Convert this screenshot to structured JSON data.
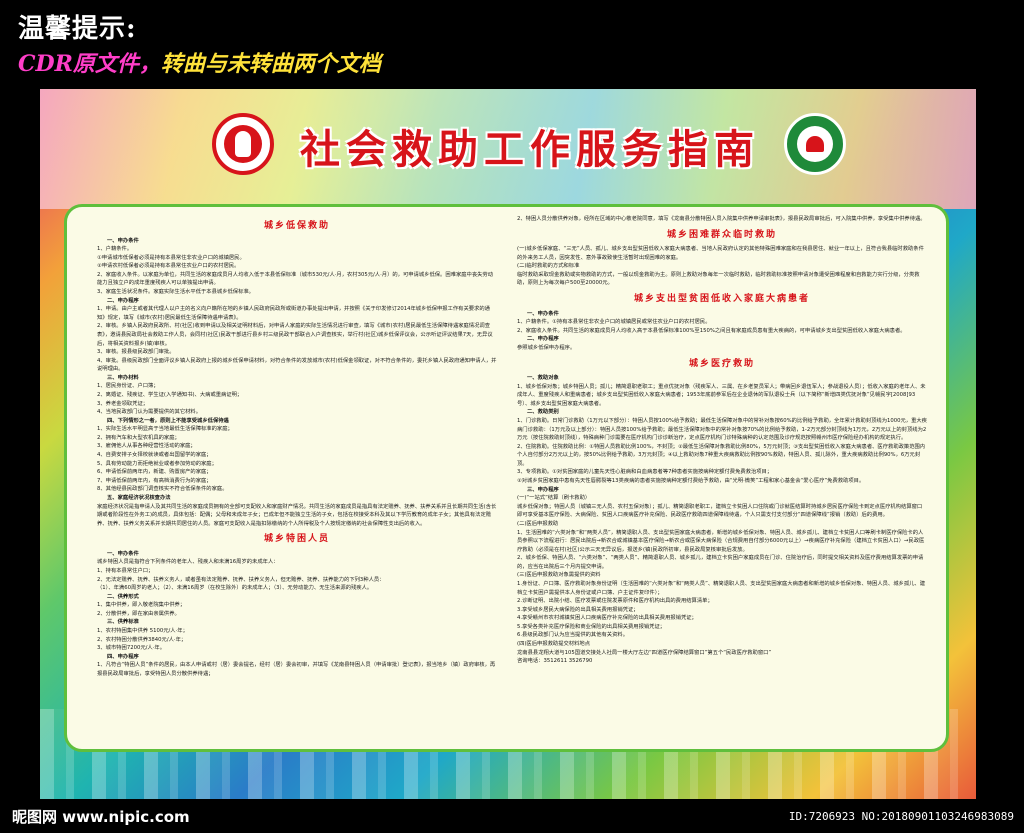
{
  "header": {
    "title": "温馨提示:",
    "subtitle_pink": "CDR原文件，",
    "subtitle_yellow": "转曲与未转曲",
    "subtitle_end": "两个文档"
  },
  "board": {
    "title": "社会救助工作服务指南"
  },
  "sections": {
    "left": [
      {
        "heading": "城乡低保救助",
        "items": [
          {
            "h": "一、申办条件"
          },
          {
            "t": "1、户籍条件。"
          },
          {
            "t": "①申请城市低保者必须是持有本县常住非农业户口的城镇居民。"
          },
          {
            "t": "②申请农村低保者必须是持有本县常住农业户口的农村居民。"
          },
          {
            "t": "2、家庭收入条件。以家庭为单位，共同生活的家庭成员月人均收入低于本县低保标准（城市530元/人·月，农村305元/人·月）的，可申请城乡低保。困难家庭中丧失劳动能力且独立户的成年重度残疾人可以单独提出申请。"
          },
          {
            "t": "3、家庭生活状况条件。家庭实际生活水平低于本县城乡低保标准。"
          },
          {
            "h": "二、申办程序"
          },
          {
            "t": "1、申请。由户主或者其代理人以户主的名义向户籍所在地的乡镇人民政府民政所或街道办事处提出申请，并按照《关于印发修订2014年城乡低保申报工作有关要求的通知》规定，填写《城市(农村)居民最低生活保障待遇申请表》。"
          },
          {
            "t": "2、审核。乡镇人民政府民政所、村(社区)收到申请以及相关证明材料后，对申请人家庭的实际生活情况进行审查，填写《城市(农村)居民最低生活保障待遇家庭情况调查表》，邀请县民政局社会救助工作人员，会同村(社区)民政干部进行县乡村三级民政干部联合入户调查核实，举行村(社区)城乡低保评议会，公示听证评议结果7天，无异议后，将相关资料报乡(镇)审核。"
          },
          {
            "t": "3、审核。报县级民政部门审批。"
          },
          {
            "t": "4、审批。县级民政部门全面评议乡镇人民政府上报的城乡低保申请材料，对符合条件的发放城市(农村)低保金领取证，对不符合条件的，委托乡镇人民政府通知申请人，并说明理由。"
          },
          {
            "h": "三、申办材料"
          },
          {
            "t": "1、居民身份证、户口簿；"
          },
          {
            "t": "2、离婚证、残疾证、学生证(入学通知书)、大病或重病证明；"
          },
          {
            "t": "3、养老金领取凭证；"
          },
          {
            "t": "4、当地民政部门认为需要提供的其它材料。"
          },
          {
            "h": "四、下列情形之一者，原则上不能享受城乡低保待遇"
          },
          {
            "t": "1、实际生活水平明显高于当地最低生活保障标准的家庭；"
          },
          {
            "t": "2、拥有汽车和大型农机具的家庭；"
          },
          {
            "t": "3、雇佣他人从事各种经营性活动的家庭；"
          },
          {
            "t": "4、自费安排子女择校就读或者出国留学的家庭；"
          },
          {
            "t": "5、具有劳动能力而拒绝就业或者参加劳动的家庭；"
          },
          {
            "t": "6、申请低保前两年内，新建、购置房产的家庭；"
          },
          {
            "t": "7、申请低保前两年内，有高档消费行为的家庭；"
          },
          {
            "t": "8、其他经县民政部门调查核实不符合低保条件的家庭。"
          },
          {
            "h": "五、家庭经济状况核查办法"
          },
          {
            "t": "家庭经济状况是指申请人及其共同生活的家庭成员拥有的全部可支配收入和家庭财产情况。共同生活的家庭成员是指具有法定赡养、抚养、扶养关系并且长期共同生活(含长期或者阶段性在外务工)的成员，具体包括：配偶；父母和未成年子女；已成年但不能独立生活的子女，包括在校接受本科及其以下学历教育的成年子女；其他具有法定赡养、抚养、扶养义务关系并长期共同居住的人员。家庭可支配收入是指扣除缴纳的个人所得税及个人按规定缴纳的社会保障性支出后的收入。"
          }
        ]
      },
      {
        "heading": "城乡特困人员",
        "items": [
          {
            "h": "一、申办条件"
          },
          {
            "t": "城乡特困人员是指符合下列条件的老年人、残疾人和未满16周岁的未成年人："
          },
          {
            "t": "1、持有本县常住户口；"
          },
          {
            "t": "2、无法定赡养、抚养、扶养义务人，或者虽有法定赡养、抚养、扶养义务人，但无赡养、抚养、扶养能力的下列3种人员："
          },
          {
            "t": "（1）、年满60周岁的老人；（2）、未满16周岁（在校生除外）的未成年人；（3）、无劳动能力、无生活来源的残疾人。"
          },
          {
            "h": "二、供养形式"
          },
          {
            "t": "1、集中供养，即入敬老院集中供养；"
          },
          {
            "t": "2、分散供养，即在家由亲属供养。"
          },
          {
            "h": "三、供养标准"
          },
          {
            "t": "1、农村特困集中供养 5100元/人·年；"
          },
          {
            "t": "2、农村特困分散供养3840元/人·年；"
          },
          {
            "t": "3、城市特困7200元/人·年。"
          },
          {
            "h": "四、申办程序"
          },
          {
            "t": "1、凡符合“特困人员”条件的居民，由本人申请或村（居）委会提名，经村（居）委会初审，并填写《龙南县特困人员（申请审批）登记表》，报当地乡（镇）政府审核，再报县民政局审批后，享受特困人员分散供养待遇；"
          }
        ]
      }
    ],
    "right": [
      {
        "heading": "",
        "items": [
          {
            "t": "2、特困人员分散供养对象，经所在区域的中心敬老院同意，填写《龙南县分散特困人员入院集中供养申请审批表》，报县民政局审批后，可入院集中供养，享受集中供养待遇。"
          }
        ]
      },
      {
        "heading": "城乡困难群众临时救助",
        "items": [
          {
            "t": "(一)城乡低保家庭、“三无”人员、孤儿、城乡支出型贫困低收入家庭大病患者、当地人民政府认定的其他特殊困难家庭和在我县居住、就业一年以上，且符合我县临时救助条件的外来务工人员，因突发性、意外事故致使生活暂时出现困难的家庭。"
          },
          {
            "t": "(二)临时救助的方式和标准"
          },
          {
            "t": "临时救助采取现金救助或实物救助的方式，一般以现金救助为主。原则上救助对象每年一次临时救助，临时救助标准按照申请对象遭受困难程度和自救能力实行分级，分类救助，原则上为每次每户500至20000元。"
          }
        ]
      },
      {
        "heading": "城乡支出型贫困低收入家庭大病患者",
        "items": [
          {
            "h": "一、申办条件"
          },
          {
            "t": "1、户籍条件。①持有本县常住非农业户口的城镇居民或常住农业户口的农村居民。"
          },
          {
            "t": "2、家庭收入条件。共同生活的家庭成员月人均收入高于本县低保标准100%至150%之间且有家庭成员患有重大疾病的，可申请城乡支出型贫困低收入家庭大病患者。"
          },
          {
            "h": "二、申办程序"
          },
          {
            "t": "参照城乡低保申办程序。"
          }
        ]
      },
      {
        "heading": "城乡医疗救助",
        "items": [
          {
            "h": "一、救助对象"
          },
          {
            "t": "1、城乡低保对象；城乡特困人员；孤儿；精简退职老职工；重点优抚对象（残疾军人、三属、在乡老复员军人；带病回乡退伍军人；参战退役人员）；低收入家庭的老年人、未成年人、重度残疾人和重病患者；城乡支出型贫困低收入家庭大病患者；1953年底前参军后在企业退休的军队退役士兵（以下简称“新增四类优抚对象”见赣民字[2008]93号）、城乡支出型贫困家庭大病患者。"
          },
          {
            "h": "二、救助类别"
          },
          {
            "t": "1、门诊救助。日常门诊救助（1万元以下部分）：特困人员按100%给予救助；最低生活保障对象中的常补对象按60%的比例给予救助，全年累计救助封顶线为1000元，重大疾病门诊救助：（1万元及以上部分）：特困人员按100%给予救助；最低生活保障对象中的常补对象按70%的比例给予救助，1-2万元部分封顶线为1万元，2万元以上的封顶线为2万元（按住院救助封顶线），特殊病种门诊需要在医疗机构门诊诊断治疗，定点医疗机构门诊特殊病种的认定范围及诊疗规范按照赣州市医疗保险经办机构的规定执行。"
          },
          {
            "t": "2、住院救助。住院救助比例：①特困人员救助比例100%，不封顶；②最低生活保障对象救助比例80%，5万元封顶；③支出型贫困低收入家庭大病患者、医疗救助政策范围内个人自付部分2万元以上的，按50%比例给予救助，3万元封顶；④以上救助对象7种重大疾病救助比例按90%救助，特困人员、孤儿除外，重大疾病救助比例90%，6万元封顶。"
          },
          {
            "t": "3、专项救助。①对贫困家庭的儿童先天性心脏病和白血病患者等7种患者实施按病种定额付费免费救治项目；"
          },
          {
            "t": "②对城乡贫困家庭中患有先天性唇腭裂等13类疾病的患者实施按病种定额付费给予救助，由“光明·微笑”工程和家心基金会“爱心医疗”免费救助项目。"
          },
          {
            "h": "三、申办程序"
          },
          {
            "t": "(一)“一站式”结算（刷卡救助）"
          },
          {
            "t": "城乡低保对象；特困人员（城镇三无人员、农村五保对象）；孤儿、精简退职老职工，建档立卡贫困人口住院或门诊就医结算时持城乡居民医疗保险卡到定点医疗机构结算窗口即可享受基本医疗保险、大病保险、贫困人口疾病医疗补充保险、民政医疗救助四道保障线待遇，个人只需支付支付部分“四道保障线”报销（救助）后的费用。"
          },
          {
            "t": "(二)医后申报救助"
          },
          {
            "t": "1、生活困难的“六类对象”和“两类人员”，精简退职人员、支出型贫困家庭大病患者，新增的城乡低保对象、特困人员、城乡孤儿、建档立卡贫困人口等刷卡制医疗保险卡的人员参照以下流程进行：居民出院后→新农合或城镇基本医疗保险→新农合或医保大病保险（合规费用自付部分6000元以上）→疾病医疗补充保险（建档立卡贫困人口）→民政医疗救助（必须是在村(社区)公示三天无异议后，报送乡(镇)民政所初审，县民政局复核审批后发放。"
          },
          {
            "t": "2、城乡低保、特困人员、“六类对象”、“两类人员”、精简退职人员、城乡孤儿，建档立卡贫困户家庭成员在门诊、住院治疗后，同时提交相关资料及医疗费用结算发票的申请的，应当在出院后三个月内提交申请。"
          },
          {
            "t": "(三)医后申报救助对象需提供的资料"
          },
          {
            "t": "1.身份证、户口簿、医疗救助对象身份证明（生活困难的“六类对象”和“两类人员”、精简退职人员、支出型贫困家庭大病患者和新增的城乡低保对象、特困人员、城乡孤儿、建档立卡贫困户需提供本人身份证或户口簿、户主证件复印件）；"
          },
          {
            "t": "2.诊断证明、出院小结、医疗发票或住院发票原件和医疗机构出具的费用结算清单；"
          },
          {
            "t": "3.享受城乡居民大病保险的出具相关费用报销凭证；"
          },
          {
            "t": "4.享受赣州市农村城镇贫困人口疾病医疗补充保险的出具相关费用报销凭证；"
          },
          {
            "t": "5.享受各类补充医疗保险和商业保险的出具相关费用报销凭证；"
          },
          {
            "t": "6.县级民政部门认为应当提供的其他有关资料。"
          },
          {
            "t": "(四)医后申报救助提交材料地点"
          },
          {
            "t": "龙南县县龙翔大道与105国道交接处人社局一楼大厅左边“四道医疗保障结算窗口”第五个“民政医疗救助窗口”"
          },
          {
            "t": "咨询电话：3512611 3526790"
          }
        ]
      }
    ]
  },
  "footer": {
    "site": "昵图网 www.nipic.com",
    "id": "ID:7206923 NO:20180901103246983089"
  }
}
